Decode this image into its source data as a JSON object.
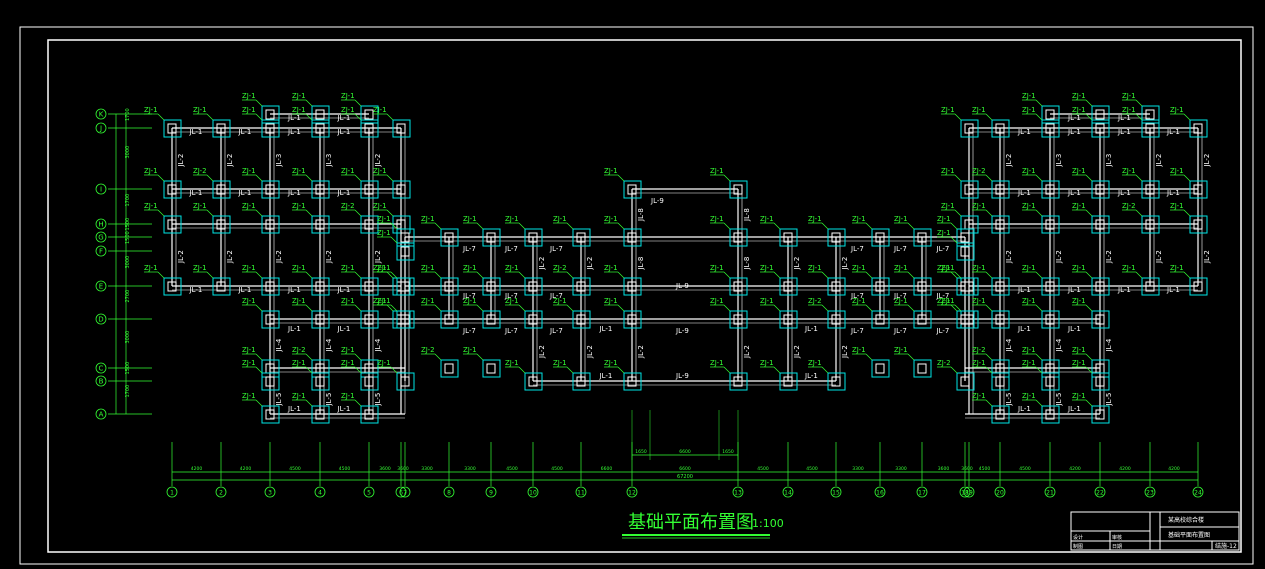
{
  "drawing": {
    "title": "基础平面布置图",
    "scale": "1:100",
    "colors": {
      "background": "#000000",
      "frame": "#ffffff",
      "grid": "#ffffff",
      "column": "#00e6e6",
      "footing_label": "#33ff33",
      "axis_bubble": "#33ff33",
      "dimension": "#33ff33",
      "beam_label": "#ffffff"
    },
    "row_axes": [
      "K",
      "J",
      "I",
      "H",
      "G",
      "F",
      "E",
      "D",
      "C",
      "B",
      "A"
    ],
    "col_axes": [
      "1",
      "2",
      "3",
      "4",
      "5",
      "6",
      "7",
      "8",
      "9",
      "10",
      "11",
      "12",
      "13",
      "14",
      "15",
      "16",
      "17",
      "18",
      "19",
      "20",
      "21",
      "22",
      "23",
      "24"
    ],
    "footing_labels": [
      "ZJ-1",
      "ZJ-2"
    ],
    "beam_labels": [
      "JL-1",
      "JL-2",
      "JL-3",
      "JL-4",
      "JL-5",
      "JL-6",
      "JL-7",
      "JL-8",
      "JL-9"
    ],
    "total_dim": "67200",
    "mid_dims": [
      "1650",
      "6600",
      "1650"
    ],
    "col_dims": [
      "4200",
      "4200",
      "4500",
      "4500",
      "3600",
      "3600",
      "3300",
      "3300",
      "4500",
      "4500",
      "6600",
      "6600",
      "4500",
      "4500",
      "3300",
      "3300",
      "3600",
      "3600",
      "4500",
      "4500",
      "4200",
      "4200",
      "4200"
    ],
    "row_dims": [
      "1700",
      "3000",
      "1700",
      "1500",
      "1500",
      "3000",
      "2700",
      "3000",
      "1500",
      "1700"
    ],
    "title_block": {
      "project": "某高校综合楼",
      "drawing_name": "基础平面布置图",
      "drawing_no": "结施-12",
      "labels": [
        "设计",
        "审核",
        "制图",
        "日期"
      ]
    }
  }
}
